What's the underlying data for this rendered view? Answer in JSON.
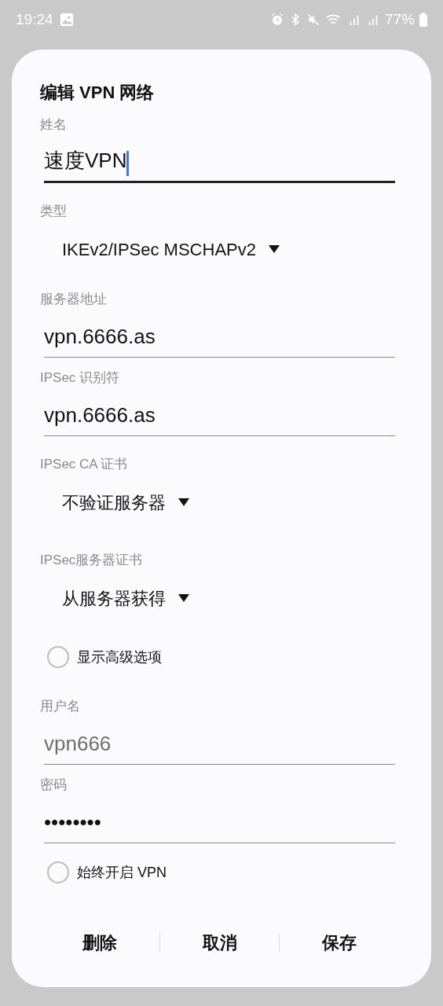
{
  "status_bar": {
    "time": "19:24",
    "battery": "77%"
  },
  "dialog": {
    "title": "编辑 VPN 网络",
    "fields": [
      {
        "kind": "text",
        "label": "姓名",
        "value": "速度VPN",
        "focused": true
      },
      {
        "kind": "dropdown",
        "label": "类型",
        "value": "IKEv2/IPSec MSCHAPv2"
      },
      {
        "kind": "text",
        "label": "服务器地址",
        "value": "vpn.6666.as",
        "focused": false
      },
      {
        "kind": "text",
        "label": "IPSec 识别符",
        "value": "vpn.6666.as",
        "focused": false
      },
      {
        "kind": "dropdown",
        "label": "IPSec CA 证书",
        "value": "不验证服务器"
      },
      {
        "kind": "dropdown",
        "label": "IPSec服务器证书",
        "value": "从服务器获得"
      },
      {
        "kind": "checkbox",
        "label": "显示高级选项",
        "checked": false
      },
      {
        "kind": "text",
        "label": "用户名",
        "placeholder": "vpn666",
        "focused": false
      },
      {
        "kind": "text",
        "label": "密码",
        "value": "••••••••",
        "focused": false
      },
      {
        "kind": "checkbox",
        "label": "始终开启 VPN",
        "checked": false
      }
    ],
    "buttons": [
      "删除",
      "取消",
      "保存"
    ]
  }
}
